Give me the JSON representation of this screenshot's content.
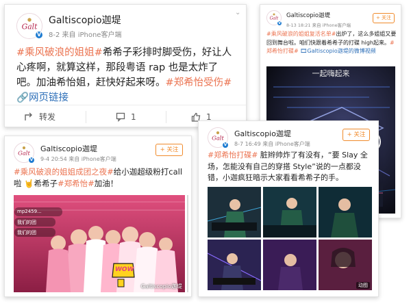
{
  "colors": {
    "hashtag": "#eb7350",
    "link": "#2d6fb8",
    "follow": "#f08a2a",
    "verified": "#1f7cd1"
  },
  "posts": [
    {
      "username": "Galtiscopio迦堤",
      "meta": "8-2  来自 iPhone客户端",
      "text_parts": [
        {
          "t": "#乘风破浪的姐姐#",
          "tag": true
        },
        {
          "t": "希希子彩排时脚受伤，好让人心疼啊，就算这样，那段粤语 rap 也是太炸了吧。加油希怡姐，赶快好起来呀。"
        },
        {
          "t": "#郑希怡受伤#",
          "tag": true
        },
        {
          "t": " 🔗网页链接",
          "link": true
        }
      ],
      "repost_label": "转发",
      "comment_count": "1",
      "like_count": "1"
    },
    {
      "username": "Galtiscopio迦堤",
      "meta": "8-13 18:21  来自 iPhone客户端",
      "follow_label": "+ 关注",
      "text_parts": [
        {
          "t": "#乘风破浪的姐姐复活名单#",
          "tag": true
        },
        {
          "t": "出炉了，这么多姐姐又要回到舞台啦。咱们快跟着希希子的打碟 high起来。"
        },
        {
          "t": "#郑希怡打碟#",
          "tag": true
        },
        {
          "t": " "
        },
        {
          "t": "🎞Galtiscopio迦堤的微博视频",
          "link": true
        }
      ],
      "video_subtitle": "一起嗨起来"
    },
    {
      "username": "Galtiscopio迦堤",
      "meta": "9-4 20:54  来自 iPhone客户端",
      "follow_label": "+ 关注",
      "text_parts": [
        {
          "t": "#乘风破浪的姐姐成团之夜#",
          "tag": true
        },
        {
          "t": "给小迦超级粉打call啦 🤘希希子"
        },
        {
          "t": "#郑希怡#",
          "tag": true
        },
        {
          "t": "加油！"
        }
      ],
      "image_comments": [
        "mp2459...",
        "我们的团",
        "我们的团"
      ],
      "image_watermark": "Galtiscopio迦堤",
      "sticker_text": "WOW"
    },
    {
      "username": "Galtiscopio迦堤",
      "meta": "8-7 16:49  来自 iPhone客户端",
      "follow_label": "+ 关注",
      "text_parts": [
        {
          "t": "#郑希怡打碟#",
          "tag": true
        },
        {
          "t": " 脏辫帅炸了有没有，“要 Slay 全场，怎能没有自己的穿搭 Style”说的一点都没错，小迦疯狂暗示大家看看希希子的手。"
        }
      ],
      "gif_label": "动图"
    }
  ]
}
